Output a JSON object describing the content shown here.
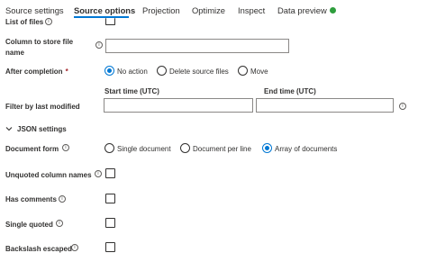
{
  "tabs": [
    {
      "label": "Source settings"
    },
    {
      "label": "Source options"
    },
    {
      "label": "Projection"
    },
    {
      "label": "Optimize"
    },
    {
      "label": "Inspect"
    },
    {
      "label": "Data preview"
    }
  ],
  "active_tab": "Source options",
  "status_color": "#2e9e3d",
  "accent_color": "#0078d4",
  "form": {
    "list_of_files": {
      "label": "List of files",
      "checked": false
    },
    "column_to_store": {
      "label_line1": "Column to store file",
      "label_line2": "name",
      "value": ""
    },
    "after_completion": {
      "label": "After completion",
      "required_mark": "*",
      "options": [
        "No action",
        "Delete source files",
        "Move"
      ],
      "selected": "No action"
    },
    "filter_last_modified": {
      "label": "Filter by last modified",
      "start_label": "Start time (UTC)",
      "end_label": "End time (UTC)",
      "start_value": "",
      "end_value": ""
    },
    "json_settings": {
      "label": "JSON settings",
      "expanded": true
    },
    "document_form": {
      "label": "Document form",
      "options": [
        "Single document",
        "Document per line",
        "Array of documents"
      ],
      "selected": "Array of documents"
    },
    "unquoted_column_names": {
      "label": "Unquoted column names",
      "checked": false
    },
    "has_comments": {
      "label": "Has comments",
      "checked": false
    },
    "single_quoted": {
      "label": "Single quoted",
      "checked": false
    },
    "backslash_escaped": {
      "label": "Backslash escaped",
      "checked": false
    }
  }
}
